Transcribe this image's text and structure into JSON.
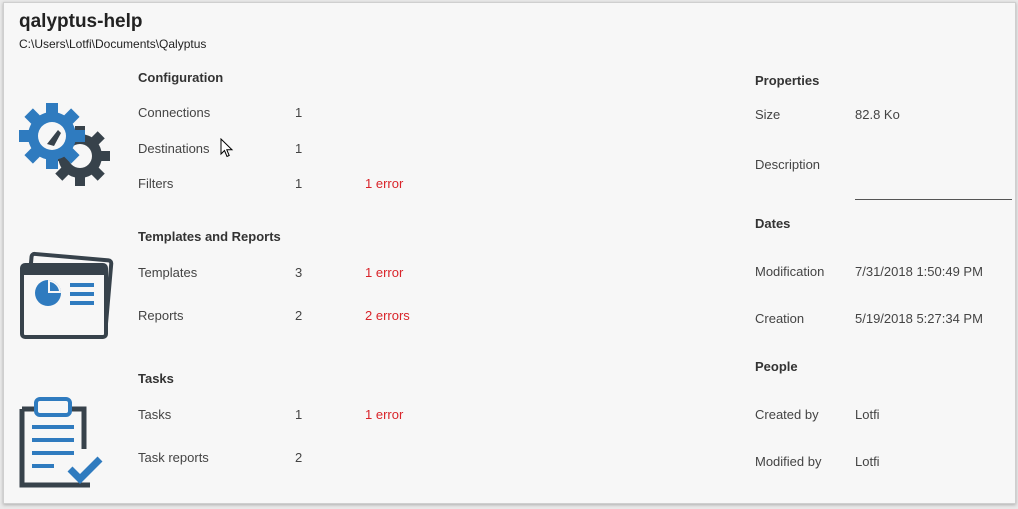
{
  "header": {
    "title": "qalyptus-help",
    "path": "C:\\Users\\Lotfi\\Documents\\Qalyptus"
  },
  "colors": {
    "icon_blue": "#2f7bbf",
    "icon_dark": "#37424b",
    "error_red": "#d9242a"
  },
  "configuration": {
    "heading": "Configuration",
    "icon": "gears-icon",
    "rows": [
      {
        "label": "Connections",
        "count": "1",
        "error": ""
      },
      {
        "label": "Destinations",
        "count": "1",
        "error": ""
      },
      {
        "label": "Filters",
        "count": "1",
        "error": "1 error"
      }
    ]
  },
  "templates_reports": {
    "heading": "Templates and Reports",
    "icon": "report-template-icon",
    "rows": [
      {
        "label": "Templates",
        "count": "3",
        "error": "1 error"
      },
      {
        "label": "Reports",
        "count": "2",
        "error": "2 errors"
      }
    ]
  },
  "tasks": {
    "heading": "Tasks",
    "icon": "clipboard-check-icon",
    "rows": [
      {
        "label": "Tasks",
        "count": "1",
        "error": "1 error"
      },
      {
        "label": "Task reports",
        "count": "2",
        "error": ""
      }
    ]
  },
  "properties": {
    "heading": "Properties",
    "size_label": "Size",
    "size_value": "82.8 Ko",
    "description_label": "Description",
    "description_value": ""
  },
  "dates": {
    "heading": "Dates",
    "modification_label": "Modification",
    "modification_value": "7/31/2018 1:50:49 PM",
    "creation_label": "Creation",
    "creation_value": "5/19/2018 5:27:34 PM"
  },
  "people": {
    "heading": "People",
    "created_by_label": "Created by",
    "created_by_value": "Lotfi",
    "modified_by_label": "Modified by",
    "modified_by_value": "Lotfi"
  }
}
